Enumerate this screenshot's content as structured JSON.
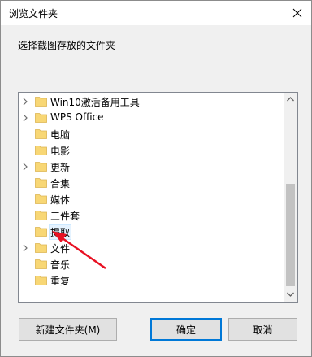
{
  "dialog": {
    "title": "浏览文件夹",
    "prompt": "选择截图存放的文件夹"
  },
  "tree": {
    "items": [
      {
        "label": "Win10激活备用工具",
        "expandable": true,
        "selected": false
      },
      {
        "label": "WPS Office",
        "expandable": true,
        "selected": false
      },
      {
        "label": "电脑",
        "expandable": false,
        "selected": false
      },
      {
        "label": "电影",
        "expandable": false,
        "selected": false
      },
      {
        "label": "更新",
        "expandable": true,
        "selected": false
      },
      {
        "label": "合集",
        "expandable": false,
        "selected": false
      },
      {
        "label": "媒体",
        "expandable": false,
        "selected": false
      },
      {
        "label": "三件套",
        "expandable": false,
        "selected": false
      },
      {
        "label": "提取",
        "expandable": false,
        "selected": true
      },
      {
        "label": "文件",
        "expandable": true,
        "selected": false
      },
      {
        "label": "音乐",
        "expandable": false,
        "selected": false
      },
      {
        "label": "重复",
        "expandable": false,
        "selected": false
      }
    ]
  },
  "buttons": {
    "new_folder": "新建文件夹(M)",
    "ok": "确定",
    "cancel": "取消"
  },
  "colors": {
    "folder": "#f8d775",
    "selection": "#e5f3ff",
    "annotation_arrow": "#e81123"
  }
}
